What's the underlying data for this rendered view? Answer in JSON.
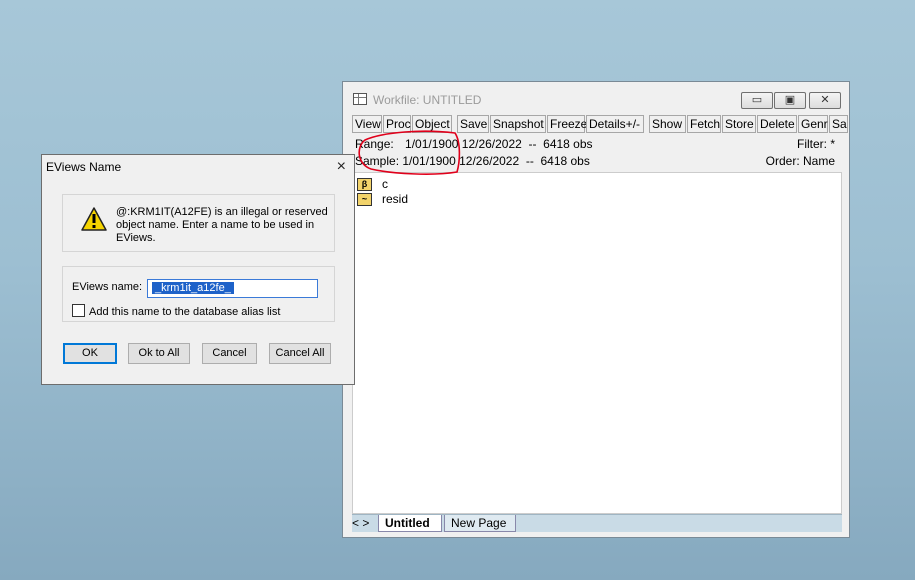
{
  "workfile": {
    "title": "Workfile: UNTITLED",
    "toolbar": [
      "View",
      "Proc",
      "Object",
      "Save",
      "Snapshot",
      "Freeze",
      "Details+/-",
      "Show",
      "Fetch",
      "Store",
      "Delete",
      "Genr",
      "Sa"
    ],
    "range_label": "Range:",
    "range_value": "1/01/1900 12/26/2022  --  6418 obs",
    "sample_label": "Sample:",
    "sample_value": "1/01/1900 12/26/2022  --  6418 obs",
    "filter": "Filter: *",
    "order": "Order: Name",
    "objects": [
      {
        "icon": "coefficient-icon",
        "glyph": "β",
        "name": "c"
      },
      {
        "icon": "series-icon",
        "glyph": "~",
        "name": "resid"
      }
    ],
    "tabs": [
      {
        "label": "Untitled",
        "active": true
      },
      {
        "label": "New Page",
        "active": false
      }
    ],
    "nav_glyph": "< >"
  },
  "dialog": {
    "title": "EViews Name",
    "close": "×",
    "message": "@:KRM1IT(A12FE) is an illegal or reserved object name.  Enter a name to be used in EViews.",
    "name_label": "EViews name:",
    "name_value": "_krm1it_a12fe_",
    "checkbox_label": "Add this name to the database alias list",
    "buttons": {
      "ok": "OK",
      "ok_to_all": "Ok to All",
      "cancel": "Cancel",
      "cancel_all": "Cancel All"
    }
  },
  "colors": {
    "accent": "#0078d7",
    "annotation": "#e0001b",
    "selection": "#1e62c9"
  }
}
